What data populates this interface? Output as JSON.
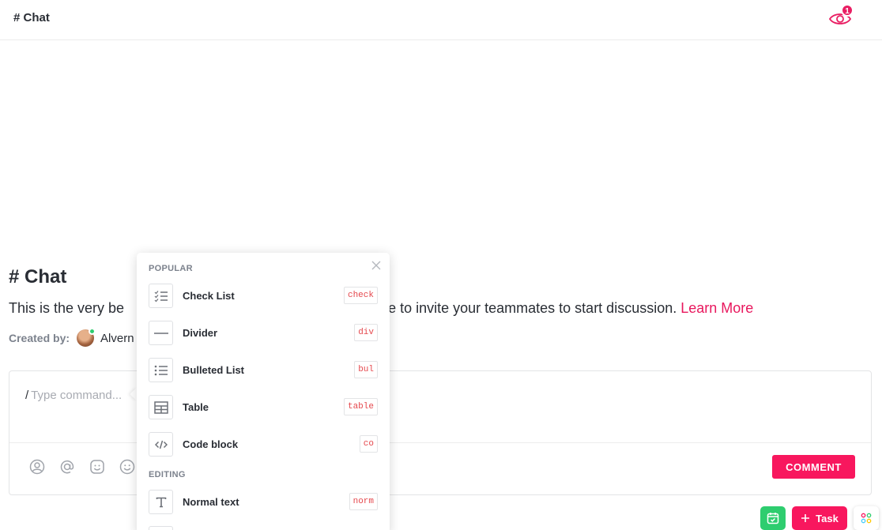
{
  "header": {
    "title": "# Chat",
    "watcher_count": "1"
  },
  "channel": {
    "title": "# Chat",
    "description_start": "This is the very be",
    "description_end": "ree to invite your teammates to start discussion. ",
    "learn_more": "Learn More",
    "created_by_label": "Created by:",
    "creator_name": "Alvern"
  },
  "composer": {
    "slash": "/",
    "placeholder": "Type command...",
    "comment_button": "COMMENT",
    "toolbar_icons": [
      "assign-icon",
      "mention-icon",
      "emoji-tag-icon",
      "smiley-icon"
    ]
  },
  "command_menu": {
    "sections": [
      "POPULAR",
      "EDITING"
    ],
    "items": [
      {
        "label": "Check List",
        "shortcut": "check",
        "icon": "checklist-icon"
      },
      {
        "label": "Divider",
        "shortcut": "div",
        "icon": "divider-icon"
      },
      {
        "label": "Bulleted List",
        "shortcut": "bul",
        "icon": "bulleted-list-icon"
      },
      {
        "label": "Table",
        "shortcut": "table",
        "icon": "table-icon"
      },
      {
        "label": "Code block",
        "shortcut": "co",
        "icon": "code-icon"
      },
      {
        "label": "Normal text",
        "shortcut": "norm",
        "icon": "text-icon"
      }
    ]
  },
  "floating": {
    "task_label": "Task"
  },
  "colors": {
    "accent": "#f8175e",
    "green": "#2ecd6f",
    "text": "#292d34",
    "muted": "#7c828d"
  }
}
